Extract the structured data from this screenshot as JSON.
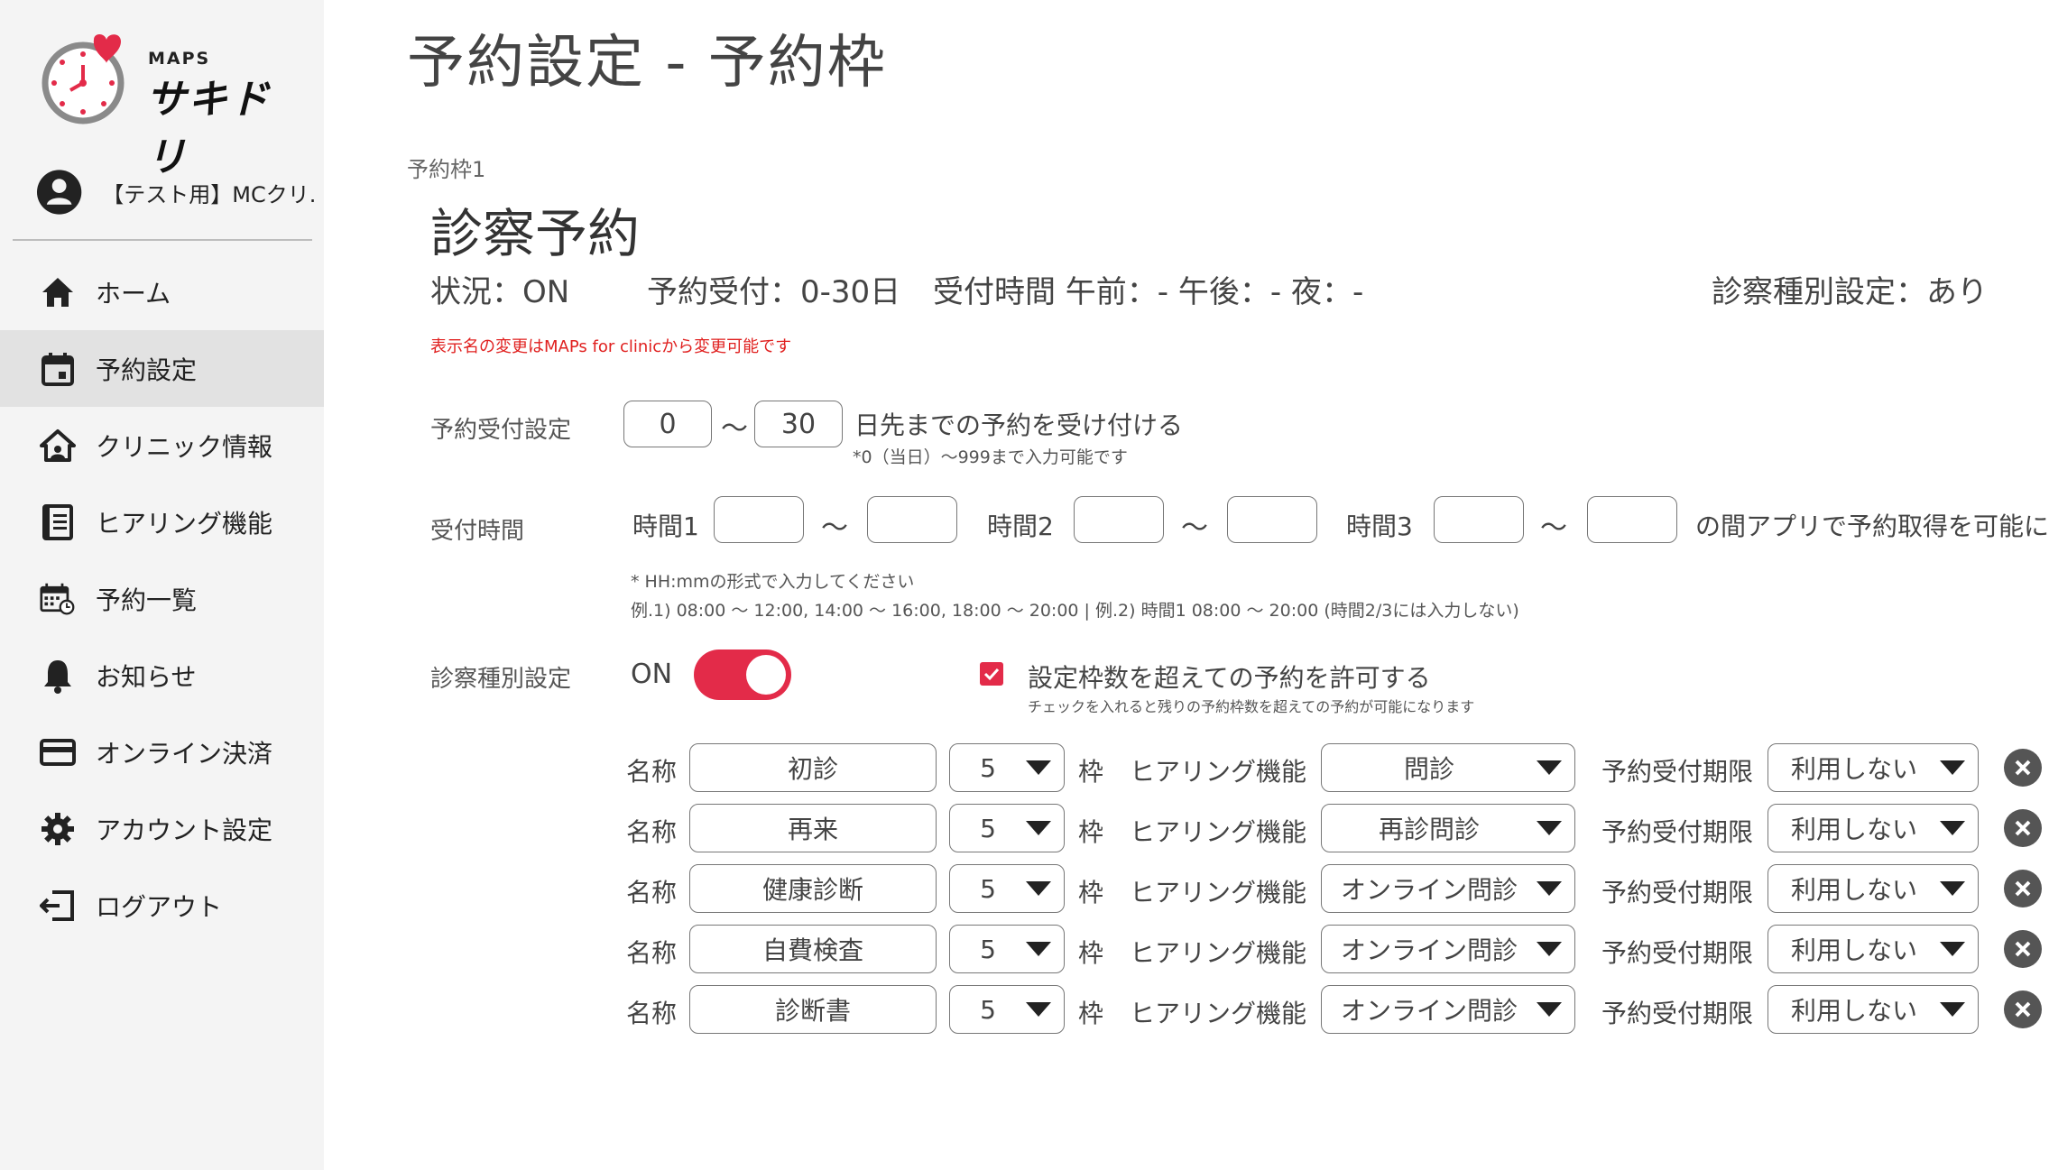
{
  "app": {
    "maps_label": "MAPS",
    "name": "サキドリ"
  },
  "user": {
    "name": "【テスト用】MCクリ..."
  },
  "nav": [
    {
      "label": "ホーム",
      "icon": "home-icon"
    },
    {
      "label": "予約設定",
      "icon": "calendar-icon",
      "active": true
    },
    {
      "label": "クリニック情報",
      "icon": "clinic-icon"
    },
    {
      "label": "ヒアリング機能",
      "icon": "list-icon"
    },
    {
      "label": "予約一覧",
      "icon": "calendar-clock-icon"
    },
    {
      "label": "お知らせ",
      "icon": "bell-icon"
    },
    {
      "label": "オンライン決済",
      "icon": "card-icon"
    },
    {
      "label": "アカウント設定",
      "icon": "gear-icon"
    },
    {
      "label": "ログアウト",
      "icon": "logout-icon"
    }
  ],
  "page": {
    "title": "予約設定 - 予約枠"
  },
  "slot": {
    "label": "予約枠1",
    "name": "診察予約",
    "status": "状況：ON",
    "reception": "予約受付：0-30日",
    "hours": "受付時間 午前：- 午後：- 夜：-",
    "type_setting": "診察種別設定：あり",
    "notice": "表示名の変更はMAPs for clinicから変更可能です"
  },
  "reception_setting": {
    "label": "予約受付設定",
    "from": "0",
    "tilde": "～",
    "to": "30",
    "suffix": "日先までの予約を受け付ける",
    "note": "*0（当日）～999まで入力可能です"
  },
  "reception_hours": {
    "label": "受付時間",
    "time1": "時間1",
    "time2": "時間2",
    "time3": "時間3",
    "tilde": "～",
    "suffix": "の間アプリで予約取得を可能に",
    "note1": "* HH:mmの形式で入力してください",
    "note2": "例.1) 08:00 ～ 12:00, 14:00 ～ 16:00, 18:00 ～ 20:00 | 例.2) 時間1 08:00 ～ 20:00 (時間2/3には入力しない)"
  },
  "type_setting": {
    "label": "診察種別設定",
    "toggle_label": "ON",
    "toggle_on": true,
    "allow_over": "設定枠数を超えての予約を許可する",
    "allow_over_note": "チェックを入れると残りの予約枠数を超えての予約が可能になります",
    "allow_over_checked": true
  },
  "row_labels": {
    "name": "名称",
    "waku": "枠",
    "hearing": "ヒアリング機能",
    "deadline": "予約受付期限"
  },
  "rows": [
    {
      "name": "初診",
      "count": "5",
      "hearing": "問診",
      "deadline": "利用しない"
    },
    {
      "name": "再来",
      "count": "5",
      "hearing": "再診問診",
      "deadline": "利用しない"
    },
    {
      "name": "健康診断",
      "count": "5",
      "hearing": "オンライン問診",
      "deadline": "利用しない"
    },
    {
      "name": "自費検査",
      "count": "5",
      "hearing": "オンライン問診",
      "deadline": "利用しない"
    },
    {
      "name": "診断書",
      "count": "5",
      "hearing": "オンライン問診",
      "deadline": "利用しない"
    }
  ],
  "colors": {
    "accent": "#e32b49",
    "notice": "#e0201f",
    "sidebar_bg": "#f4f4f4",
    "active_bg": "#e2e2e2"
  }
}
